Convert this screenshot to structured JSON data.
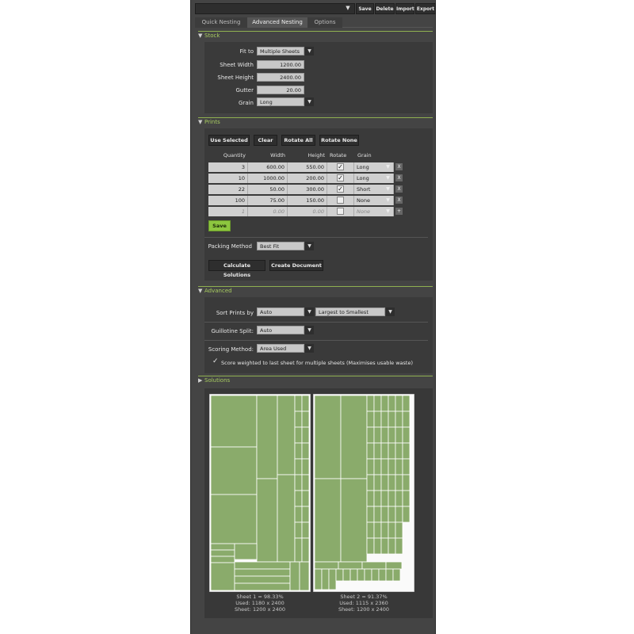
{
  "toolbar": {
    "preset_value": "",
    "save_label": "Save",
    "delete_label": "Delete",
    "import_label": "Import",
    "export_label": "Export"
  },
  "tabs": [
    {
      "label": "Quick Nesting"
    },
    {
      "label": "Advanced Nesting"
    },
    {
      "label": "Options"
    }
  ],
  "stock": {
    "title": "Stock",
    "fit_to_label": "Fit to",
    "fit_to_value": "Multiple Sheets",
    "sheet_width_label": "Sheet Width",
    "sheet_width_value": "1200.00",
    "sheet_height_label": "Sheet Height",
    "sheet_height_value": "2400.00",
    "gutter_label": "Gutter",
    "gutter_value": "20.00",
    "grain_label": "Grain",
    "grain_value": "Long"
  },
  "prints": {
    "title": "Prints",
    "use_selected_label": "Use Selected",
    "clear_label": "Clear",
    "rotate_all_label": "Rotate All",
    "rotate_none_label": "Rotate None",
    "columns": [
      "Quantity",
      "Width",
      "Height",
      "Rotate",
      "Grain"
    ],
    "rows": [
      {
        "quantity": "3",
        "width": "600.00",
        "height": "550.00",
        "rotate": true,
        "grain": "Long"
      },
      {
        "quantity": "10",
        "width": "1000.00",
        "height": "200.00",
        "rotate": true,
        "grain": "Long"
      },
      {
        "quantity": "22",
        "width": "50.00",
        "height": "300.00",
        "rotate": true,
        "grain": "Short"
      },
      {
        "quantity": "100",
        "width": "75.00",
        "height": "150.00",
        "rotate": false,
        "grain": "None"
      }
    ],
    "new_row": {
      "quantity": "1",
      "width": "0.00",
      "height": "0.00",
      "rotate": false,
      "grain": "None"
    },
    "remove_symbol": "X",
    "add_symbol": "+",
    "save_label": "Save",
    "packing_label": "Packing Method",
    "packing_value": "Best Fit",
    "calculate_label": "Calculate Solutions",
    "create_doc_label": "Create Document"
  },
  "advanced": {
    "title": "Advanced",
    "sort_label": "Sort Prints by",
    "sort_value": "Auto",
    "sort_order_value": "Largest to Smallest",
    "guillotine_label": "Guillotine Split:",
    "guillotine_value": "Auto",
    "scoring_label": "Scoring Method:",
    "scoring_value": "Area Used",
    "score_weighted_checked": true,
    "score_weighted_label": "Score weighted to last sheet for multiple sheets (Maximises usable waste)"
  },
  "solutions": {
    "title": "Solutions",
    "sheets": [
      {
        "line1": "Sheet 1 = 98.33%",
        "line2": "Used: 1180 x 2400",
        "line3": "Sheet: 1200 x 2400",
        "used_percent": 98.33
      },
      {
        "line1": "Sheet 2 = 91.37%",
        "line2": "Used: 1115 x 2360",
        "line3": "Sheet: 1200 x 2400",
        "used_percent": 91.37
      }
    ]
  },
  "colors": {
    "accent": "#8dc63f",
    "section_title": "#a8cc60",
    "piece_fill": "#8aab6b",
    "piece_stroke": "#ffffff",
    "panel_bg": "#444444"
  },
  "icons": {
    "collapse": "triangle-down-icon",
    "expand": "triangle-right-icon",
    "check": "check-icon",
    "dropdown": "chevron-down-icon"
  }
}
